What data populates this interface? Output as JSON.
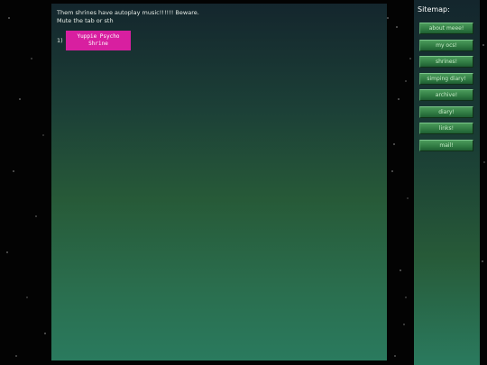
{
  "main": {
    "notice": "Them shrines have autoplay music!!!!!! Beware.\nMute the tab or sth",
    "shrines": [
      {
        "index": "1)",
        "label": "Yuppie Psycho\nShrine"
      }
    ]
  },
  "sidebar": {
    "title": "Sitemap:",
    "items": [
      {
        "label": "about meee!"
      },
      {
        "label": "my ocs!"
      },
      {
        "label": "shrines!"
      },
      {
        "label": "simping diary!"
      },
      {
        "label": "archive!"
      },
      {
        "label": "diary!"
      },
      {
        "label": "links!"
      },
      {
        "label": "mail!"
      }
    ]
  },
  "colors": {
    "shrine_button": "#d81fa0",
    "nav_button": "#2f7a42",
    "panel_top": "#14262d",
    "panel_bottom": "#2a7a5e"
  }
}
